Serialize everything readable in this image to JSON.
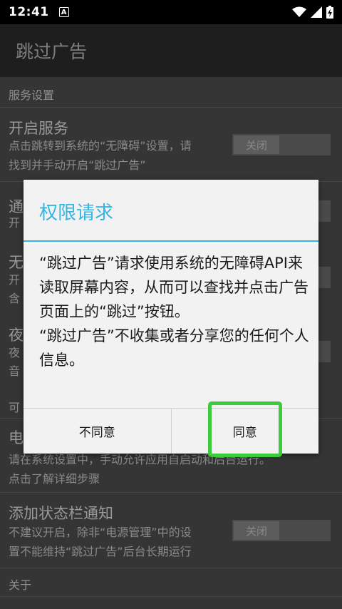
{
  "status_bar": {
    "time": "12:41",
    "notification_icon_letter": "A",
    "icons": [
      "a-notification-icon",
      "wifi-icon",
      "signal-icon",
      "battery-charging-icon"
    ]
  },
  "app_bar": {
    "title": "跳过广告"
  },
  "settings": {
    "section_service": "服务设置",
    "service_title": "开启服务",
    "service_sub_1": "点击跳转到系统的“无障碍”设置，请",
    "service_sub_2": "找到并手动开启“跳过广告”",
    "service_toggle": "关闭",
    "item2_partial_title": "通",
    "item2_partial_sub": "开",
    "item3_partial_title": "无",
    "item3_partial_sub_1": "开",
    "item3_partial_sub_2": "含",
    "item4_partial_title": "夜",
    "item4_partial_sub_1": "夜",
    "item4_partial_sub_2": "音",
    "section_partial": "可",
    "power_partial_title": "电",
    "power_sub_1": "请在系统设置中，手动允许应用自启动和后台运行。",
    "power_sub_2": "点击了解详细步骤",
    "notify_title": "添加状态栏通知",
    "notify_sub_1": "不建议开启，除非“电源管理”中的设",
    "notify_sub_2": "置不能维持“跳过广告”后台长期运行",
    "notify_toggle": "关闭",
    "section_about": "关于"
  },
  "dialog": {
    "title": "权限请求",
    "message_1": "“跳过广告”请求使用系统的无障碍API来读取屏幕内容，从而可以查找并点击广告页面上的“跳过”按钮。",
    "message_2": "“跳过广告”不收集或者分享您的任何个人信息。",
    "decline": "不同意",
    "accept": "同意"
  },
  "colors": {
    "accent": "#33b5e5",
    "highlight": "#3ccb3c"
  }
}
